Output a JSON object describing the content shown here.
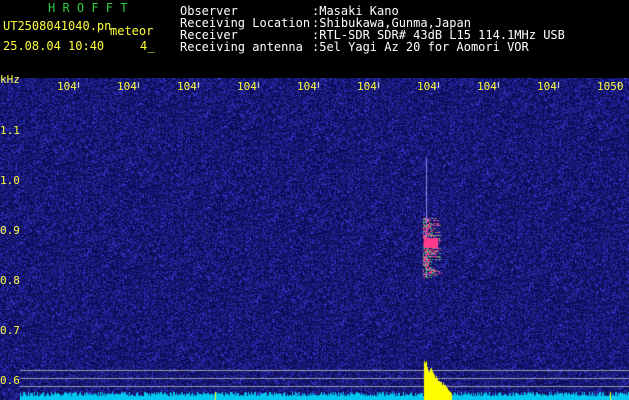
{
  "app": {
    "logo": "H R O F F T",
    "filename": "UT2508041040.pn",
    "mode": "meteor",
    "date_time": "25.08.04 10:40",
    "counter": "4_"
  },
  "info": [
    {
      "label": "Observer",
      "value": ":Masaki Kano"
    },
    {
      "label": "Receiving Location",
      "value": ":Shibukawa,Gunma,Japan"
    },
    {
      "label": "Receiver",
      "value": ":RTL-SDR SDR# 43dB L15 114.1MHz USB"
    },
    {
      "label": "Receiving antenna",
      "value": ":5el Yagi Az 20 for Aomori VOR"
    }
  ],
  "spectrogram": {
    "y_unit": "kHz",
    "y_ticks": [
      "1.1",
      "1.0",
      "0.9",
      "0.8",
      "0.7",
      "0.6"
    ],
    "x_ticks": [
      "104",
      "104",
      "104",
      "104",
      "104",
      "104",
      "104",
      "104",
      "104",
      "1050"
    ],
    "colors": {
      "background": "#0c0c5a",
      "noise": "#3a3ad0",
      "echo_core": "#ff3c8c",
      "echo_edge": "#32c878",
      "level_bar": "#00c8f0",
      "level_peak": "#ffff00",
      "text": "#ffff3c"
    }
  }
}
